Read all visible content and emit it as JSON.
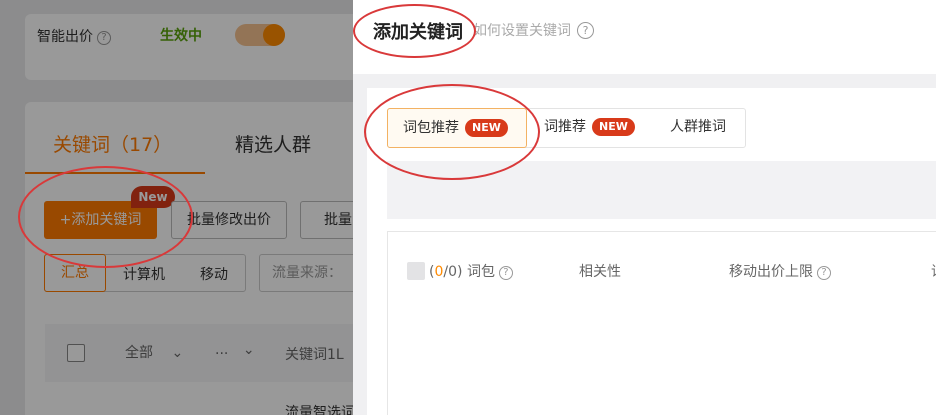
{
  "background": {
    "smart_bid": {
      "label": "智能出价",
      "status": "生效中",
      "toggle_on": true
    },
    "tabs": {
      "keywords": "关键词（17）",
      "crowd": "精选人群"
    },
    "add_keyword_button": "+添加关键词",
    "new_badge": "New",
    "batch_edit_bid": "批量修改出价",
    "batch_match": "批量匹",
    "segments": [
      "汇总",
      "计算机",
      "移动"
    ],
    "traffic_source": "流量来源：",
    "table": {
      "all": "全部",
      "dots": "...",
      "keyword": "关键词1L",
      "bottom_text": "流量智选词"
    }
  },
  "drawer": {
    "title": "添加关键词",
    "help_link": "如何设置关键词",
    "tabs": [
      {
        "label": "词包推荐",
        "badge": "NEW",
        "active": true
      },
      {
        "label": "词推荐",
        "badge": "NEW",
        "active": false
      },
      {
        "label": "人群推词",
        "badge": "",
        "active": false
      }
    ],
    "table": {
      "selected": "0",
      "total": "0",
      "col_package": "词包",
      "col_relevance": "相关性",
      "col_mobile_bid": "移动出价上限",
      "col_cut": "词"
    }
  },
  "colors": {
    "accent": "#ff7a00",
    "badge_red": "#d83a1a",
    "annotation": "#d9393a",
    "status_green": "#5aa20d"
  },
  "icons": [
    "help-icon",
    "chevron-down-icon",
    "toggle-switch"
  ]
}
